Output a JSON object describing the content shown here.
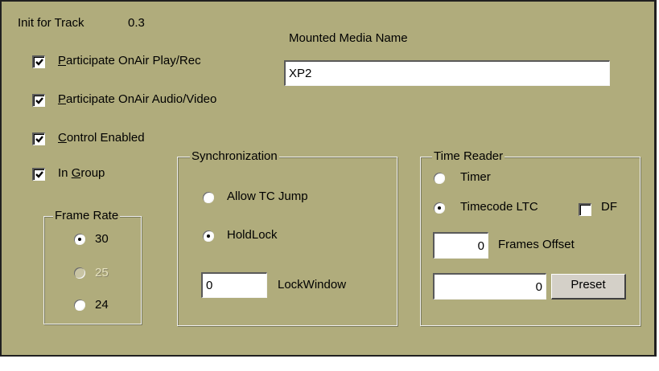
{
  "init": {
    "label": "Init for Track",
    "value": "0.3"
  },
  "media": {
    "label": "Mounted Media Name",
    "value": "XP2"
  },
  "checks": [
    {
      "pre": "",
      "u": "P",
      "post": "articipate OnAir Play/Rec",
      "checked": true
    },
    {
      "pre": "",
      "u": "P",
      "post": "articipate OnAir Audio/Video",
      "checked": true
    },
    {
      "pre": "",
      "u": "C",
      "post": "ontrol Enabled",
      "checked": true
    },
    {
      "pre": "In ",
      "u": "G",
      "post": "roup",
      "checked": true
    }
  ],
  "frame_rate": {
    "title": "Frame Rate",
    "options": [
      {
        "label": "30",
        "selected": true,
        "enabled": true
      },
      {
        "label": "25",
        "selected": false,
        "enabled": false
      },
      {
        "label": "24",
        "selected": false,
        "enabled": true
      }
    ]
  },
  "sync": {
    "title": "Synchronization",
    "options": [
      {
        "label": "Allow TC Jump",
        "selected": false
      },
      {
        "label": "HoldLock",
        "selected": true
      }
    ],
    "lock_value": "0",
    "lock_label": "LockWindow"
  },
  "time_reader": {
    "title": "Time Reader",
    "timer_label": "Timer",
    "timecode_label": "Timecode LTC",
    "df_label": "DF",
    "df_checked": false,
    "frames_value": "0",
    "frames_label": "Frames Offset",
    "preset_value": "0",
    "preset_label": "Preset",
    "selected": "timecode"
  }
}
